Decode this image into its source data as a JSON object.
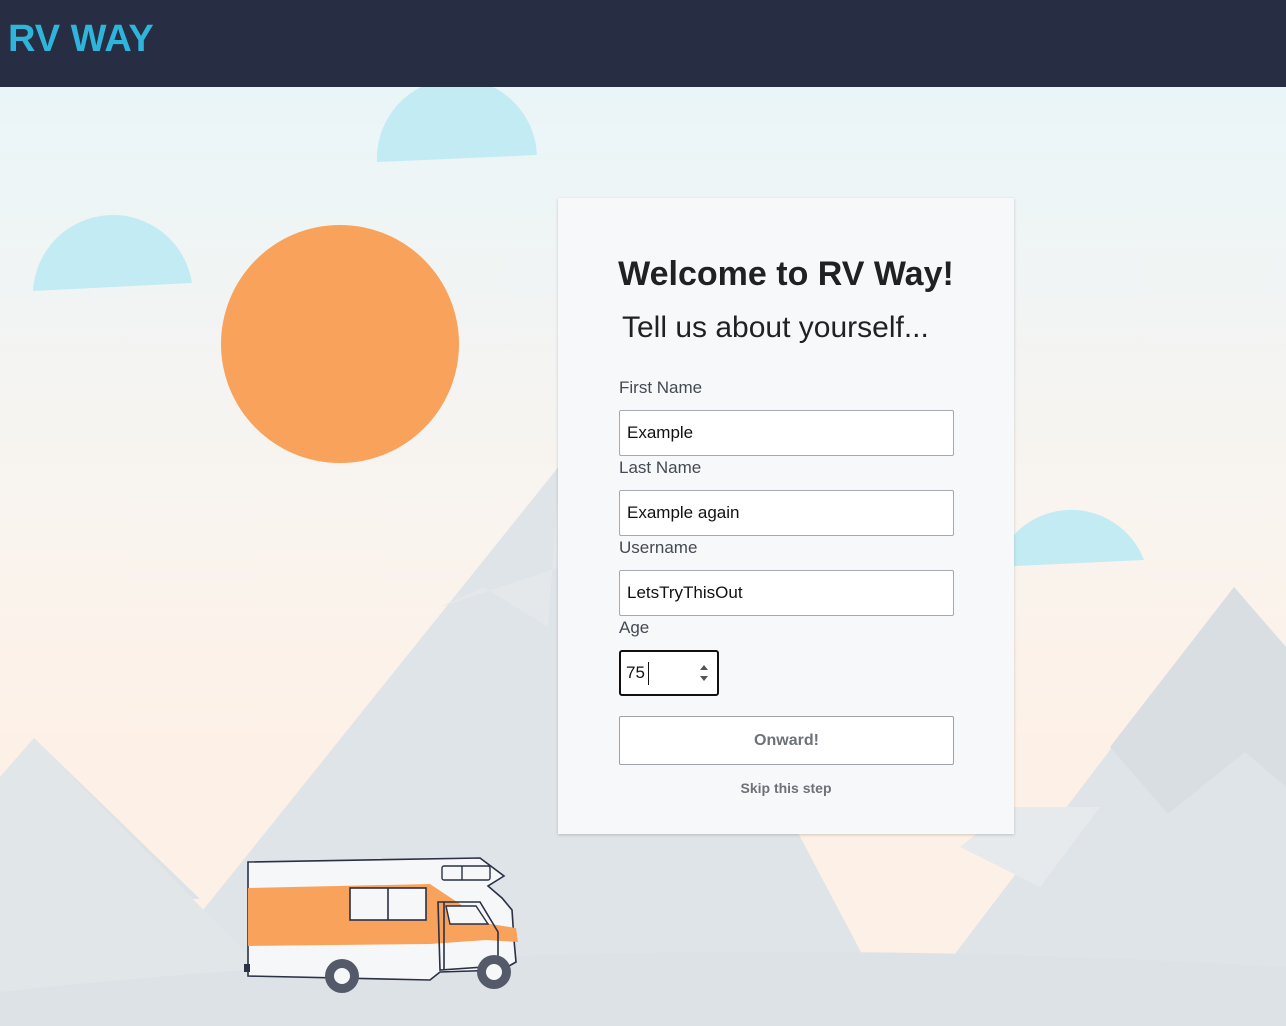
{
  "header": {
    "brand": "RV WAY"
  },
  "colors": {
    "header_bg": "#272d42",
    "brand": "#2fb4dc",
    "sun": "#f9a25c",
    "cloud": "#c3ebf4",
    "mountain": "#dfe4e8"
  },
  "form": {
    "title": "Welcome to RV Way!",
    "subtitle": "Tell us about yourself...",
    "first_name": {
      "label": "First Name",
      "value": "Example"
    },
    "last_name": {
      "label": "Last Name",
      "value": "Example again"
    },
    "username": {
      "label": "Username",
      "value": "LetsTryThisOut"
    },
    "age": {
      "label": "Age",
      "value": "75"
    },
    "submit_label": "Onward!",
    "skip_label": "Skip this step"
  }
}
